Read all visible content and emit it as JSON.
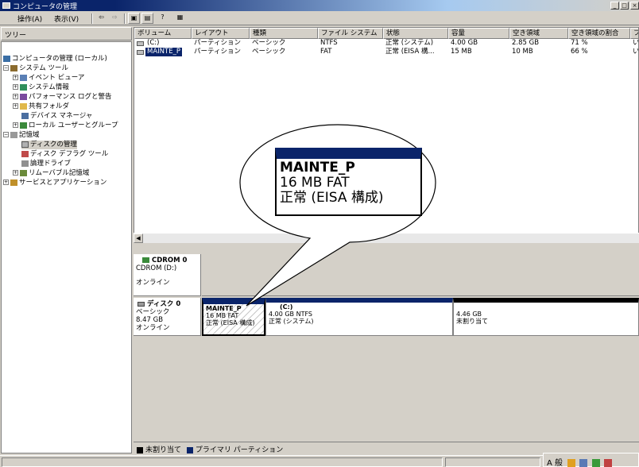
{
  "window": {
    "title": "コンピュータの管理",
    "controls": [
      "_",
      "□",
      "×"
    ]
  },
  "menu": {
    "action": "操作(A)",
    "view": "表示(V)"
  },
  "tree": {
    "header": "ツリー",
    "items": [
      {
        "label": "コンピュータの管理 (ローカル)",
        "level": 0,
        "icon": "computer-icon"
      },
      {
        "label": "システム ツール",
        "level": 1,
        "icon": "tools-icon"
      },
      {
        "label": "イベント ビューア",
        "level": 2,
        "icon": "event-viewer-icon"
      },
      {
        "label": "システム情報",
        "level": 2,
        "icon": "system-info-icon"
      },
      {
        "label": "パフォーマンス ログと警告",
        "level": 2,
        "icon": "performance-icon"
      },
      {
        "label": "共有フォルダ",
        "level": 2,
        "icon": "shared-folder-icon"
      },
      {
        "label": "デバイス マネージャ",
        "level": 2,
        "icon": "device-manager-icon"
      },
      {
        "label": "ローカル ユーザーとグループ",
        "level": 2,
        "icon": "users-icon"
      },
      {
        "label": "記憶域",
        "level": 1,
        "icon": "storage-icon"
      },
      {
        "label": "ディスクの管理",
        "level": 2,
        "icon": "disk-management-icon",
        "selected": true
      },
      {
        "label": "ディスク デフラグ ツール",
        "level": 2,
        "icon": "defrag-icon"
      },
      {
        "label": "論理ドライブ",
        "level": 2,
        "icon": "logical-drive-icon"
      },
      {
        "label": "リムーバブル記憶域",
        "level": 2,
        "icon": "removable-storage-icon"
      },
      {
        "label": "サービスとアプリケーション",
        "level": 1,
        "icon": "services-icon"
      }
    ]
  },
  "volumes": {
    "columns": [
      "ボリューム",
      "レイアウト",
      "種類",
      "ファイル システム",
      "状態",
      "容量",
      "空き領域",
      "空き領域の割合",
      "フォ"
    ],
    "rows": [
      [
        "(C:)",
        "パーティション",
        "ベーシック",
        "NTFS",
        "正常 (システム)",
        "4.00 GB",
        "2.85 GB",
        "71 %",
        "い"
      ],
      [
        "MAINTE_P",
        "パーティション",
        "ベーシック",
        "FAT",
        "正常 (EISA 構...",
        "15 MB",
        "10 MB",
        "66 %",
        "い"
      ]
    ]
  },
  "disks": {
    "cdrom": {
      "name": "CDROM 0",
      "line1": "CDROM (D:)",
      "status": "オンライン"
    },
    "disk0": {
      "name": "ディスク 0",
      "type": "ベーシック",
      "size": "8.47 GB",
      "status": "オンライン"
    },
    "partitions": [
      {
        "name": "MAINTE_P",
        "size": "16 MB FAT",
        "status": "正常 (EISA 構成)"
      },
      {
        "name": "(C:)",
        "size": "4.00 GB NTFS",
        "status": "正常 (システム)"
      },
      {
        "name": "",
        "size": "4.46 GB",
        "status": "未割り当て"
      }
    ]
  },
  "callout": {
    "name": "MAINTE_P",
    "size": "16 MB FAT",
    "status": "正常 (EISA 構成)"
  },
  "legend": {
    "unallocated": "未割り当て",
    "primary": "プライマリ パーティション"
  },
  "tray": {
    "text": "A 般"
  },
  "colors": {
    "primary": "#0a246a",
    "unallocated": "#000000",
    "title_gradient_end": "#a6caf0"
  }
}
